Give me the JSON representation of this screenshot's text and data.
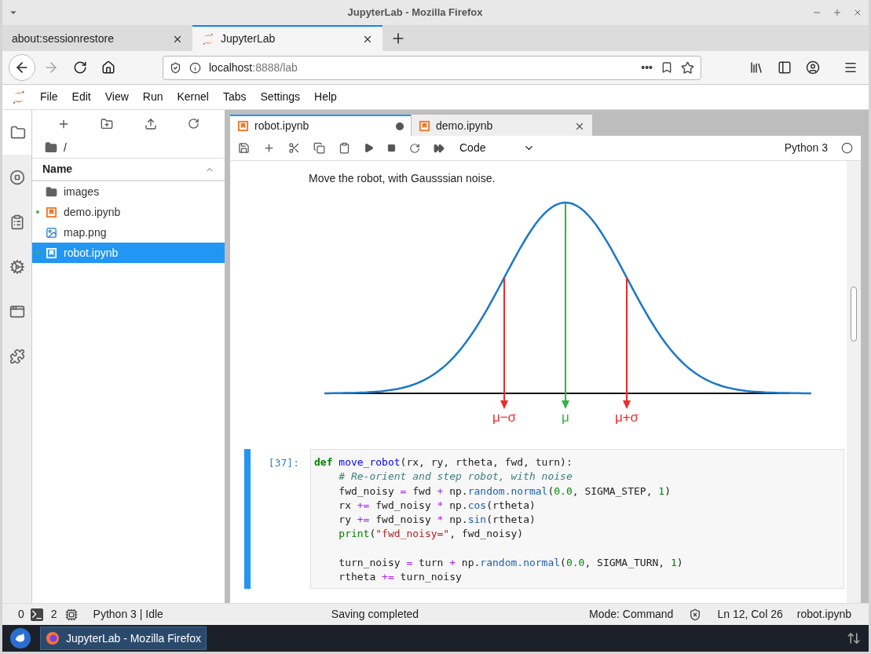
{
  "window": {
    "title": "JupyterLab - Mozilla Firefox"
  },
  "browser_tabs": [
    {
      "label": "about:sessionrestore",
      "selected": false,
      "kind": "plain"
    },
    {
      "label": "JupyterLab",
      "selected": true,
      "kind": "jupyter"
    }
  ],
  "address": {
    "host": "localhost",
    "path": ":8888/lab"
  },
  "page_actions": "•••",
  "menu": [
    "File",
    "Edit",
    "View",
    "Run",
    "Kernel",
    "Tabs",
    "Settings",
    "Help"
  ],
  "side_rail": [
    {
      "kind": "folder",
      "selected": true
    },
    {
      "kind": "running",
      "selected": false
    },
    {
      "kind": "commands",
      "selected": false
    },
    {
      "kind": "properties",
      "selected": false
    },
    {
      "kind": "tabs",
      "selected": false
    },
    {
      "kind": "extensions",
      "selected": false
    }
  ],
  "file_browser": {
    "path": "/",
    "column": "Name",
    "items": [
      {
        "name": "images",
        "kind": "folder",
        "running": false,
        "selected": false
      },
      {
        "name": "demo.ipynb",
        "kind": "notebook",
        "running": true,
        "selected": false
      },
      {
        "name": "map.png",
        "kind": "image",
        "running": false,
        "selected": false
      },
      {
        "name": "robot.ipynb",
        "kind": "notebook",
        "running": true,
        "selected": true
      }
    ]
  },
  "notebook_tabs": [
    {
      "label": "robot.ipynb",
      "selected": true,
      "dirty": true
    },
    {
      "label": "demo.ipynb",
      "selected": false,
      "dirty": false
    }
  ],
  "notebook_toolbar": {
    "cell_type": "Code",
    "kernel": "Python 3",
    "kernel_busy": false
  },
  "markdown": "Move the robot, with Gausssian noise.",
  "figure": {
    "labels": [
      {
        "text": "μ−σ",
        "color": "#ee2a2a"
      },
      {
        "text": "μ",
        "color": "#2fb340"
      },
      {
        "text": "μ+σ",
        "color": "#ee2a2a"
      }
    ]
  },
  "code_cell": {
    "prompt": "[37]:",
    "lines": [
      {
        "kind": "code",
        "tokens": [
          {
            "kind": "keyword",
            "text": "def"
          },
          {
            "kind": "name",
            "text": " move_robot"
          },
          {
            "kind": "plain",
            "text": "(rx, ry, rtheta, fwd, turn):"
          }
        ]
      },
      {
        "kind": "code",
        "tokens": [
          {
            "kind": "comment",
            "text": "    # Re-orient and step robot, with noise"
          }
        ]
      },
      {
        "kind": "code",
        "tokens": [
          {
            "kind": "plain",
            "text": "    fwd_noisy "
          },
          {
            "kind": "operator",
            "text": "="
          },
          {
            "kind": "plain",
            "text": " fwd "
          },
          {
            "kind": "operator",
            "text": "+"
          },
          {
            "kind": "plain",
            "text": " np."
          },
          {
            "kind": "attribute",
            "text": "random.normal"
          },
          {
            "kind": "plain",
            "text": "("
          },
          {
            "kind": "number",
            "text": "0.0"
          },
          {
            "kind": "plain",
            "text": ", SIGMA_STEP, "
          },
          {
            "kind": "number",
            "text": "1"
          },
          {
            "kind": "plain",
            "text": ")"
          }
        ]
      },
      {
        "kind": "code",
        "tokens": [
          {
            "kind": "plain",
            "text": "    rx "
          },
          {
            "kind": "operator",
            "text": "+="
          },
          {
            "kind": "plain",
            "text": " fwd_noisy "
          },
          {
            "kind": "operator",
            "text": "*"
          },
          {
            "kind": "plain",
            "text": " np."
          },
          {
            "kind": "attribute",
            "text": "cos"
          },
          {
            "kind": "plain",
            "text": "(rtheta)"
          }
        ]
      },
      {
        "kind": "code",
        "tokens": [
          {
            "kind": "plain",
            "text": "    ry "
          },
          {
            "kind": "operator",
            "text": "+="
          },
          {
            "kind": "plain",
            "text": " fwd_noisy "
          },
          {
            "kind": "operator",
            "text": "*"
          },
          {
            "kind": "plain",
            "text": " np."
          },
          {
            "kind": "attribute",
            "text": "sin"
          },
          {
            "kind": "plain",
            "text": "(rtheta)"
          }
        ]
      },
      {
        "kind": "code",
        "tokens": [
          {
            "kind": "builtin",
            "text": "    print"
          },
          {
            "kind": "plain",
            "text": "("
          },
          {
            "kind": "string",
            "text": "\"fwd_noisy=\""
          },
          {
            "kind": "plain",
            "text": ", fwd_noisy)"
          }
        ]
      },
      {
        "kind": "blank"
      },
      {
        "kind": "code",
        "tokens": [
          {
            "kind": "plain",
            "text": "    turn_noisy "
          },
          {
            "kind": "operator",
            "text": "="
          },
          {
            "kind": "plain",
            "text": " turn "
          },
          {
            "kind": "operator",
            "text": "+"
          },
          {
            "kind": "plain",
            "text": " np."
          },
          {
            "kind": "attribute",
            "text": "random.normal"
          },
          {
            "kind": "plain",
            "text": "("
          },
          {
            "kind": "number",
            "text": "0.0"
          },
          {
            "kind": "plain",
            "text": ", SIGMA_TURN, "
          },
          {
            "kind": "number",
            "text": "1"
          },
          {
            "kind": "plain",
            "text": ")"
          }
        ]
      },
      {
        "kind": "code",
        "tokens": [
          {
            "kind": "plain",
            "text": "    rtheta "
          },
          {
            "kind": "operator",
            "text": "+="
          },
          {
            "kind": "plain",
            "text": " turn_noisy"
          }
        ]
      }
    ]
  },
  "status_bar": {
    "terminals": "0",
    "kernels": "2",
    "kernel_status": "Python 3 | Idle",
    "message": "Saving completed",
    "mode": "Mode: Command",
    "position": "Ln 12, Col 26",
    "file": "robot.ipynb"
  },
  "taskbar": {
    "task": "JupyterLab - Mozilla Firefox"
  }
}
